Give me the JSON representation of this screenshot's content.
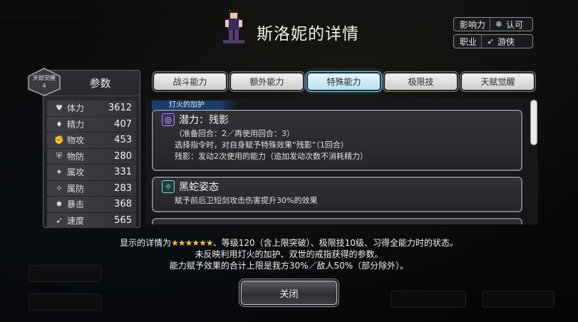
{
  "header": {
    "title": "斯洛妮的详情",
    "influence_label": "影响力",
    "influence_value": "认可",
    "job_label": "职业",
    "job_value": "游侠"
  },
  "stats_panel": {
    "title": "参数",
    "badge_line1": "天赋觉醒",
    "badge_line2": "4",
    "items": [
      {
        "label": "体力",
        "value": "3612",
        "icon": "heart-icon"
      },
      {
        "label": "精力",
        "value": "407",
        "icon": "drop-icon"
      },
      {
        "label": "物攻",
        "value": "453",
        "icon": "fist-icon"
      },
      {
        "label": "物防",
        "value": "280",
        "icon": "shield-hand-icon"
      },
      {
        "label": "属攻",
        "value": "331",
        "icon": "sparkle-hand-icon"
      },
      {
        "label": "属防",
        "value": "283",
        "icon": "magic-shield-icon"
      },
      {
        "label": "暴击",
        "value": "368",
        "icon": "crit-icon"
      },
      {
        "label": "速度",
        "value": "565",
        "icon": "boot-icon"
      }
    ]
  },
  "tabs": [
    {
      "label": "战斗能力",
      "active": false
    },
    {
      "label": "额外能力",
      "active": false
    },
    {
      "label": "特殊能力",
      "active": true
    },
    {
      "label": "极限技",
      "active": false
    },
    {
      "label": "天赋觉醒",
      "active": false
    }
  ],
  "content": {
    "section_label": "灯火的加护",
    "cards": [
      {
        "title": "潜力：残影",
        "icon": "potential-icon",
        "lines": [
          "（准备回合：2／再使用回合：3）",
          "选择指令时，对自身赋予特殊效果“残影”（1回合）",
          "残影：发动2次使用的能力（追加发动次数不消耗精力）"
        ]
      },
      {
        "title": "黑蛇姿态",
        "icon": "snake-stance-icon",
        "lines": [
          "赋予前后卫短剑攻击伤害提升30%的效果"
        ]
      }
    ]
  },
  "footer": {
    "note_prefix": "显示的详情为",
    "stars": "★★★★★★",
    "note_line1_rest": "、等级120（含上限突破）、极限技10级、习得全能力时的状态。",
    "note_line2": "未反映利用灯火的加护、双世的戒指获得的参数。",
    "note_line3": "能力赋予效果的合计上限是我方30%／敌人50%（部分除外）。",
    "close_label": "关闭"
  },
  "colors": {
    "active_tab_glow": "#58c7ee",
    "star": "#f1c232",
    "section_label_bg": "#1c3e6a"
  }
}
